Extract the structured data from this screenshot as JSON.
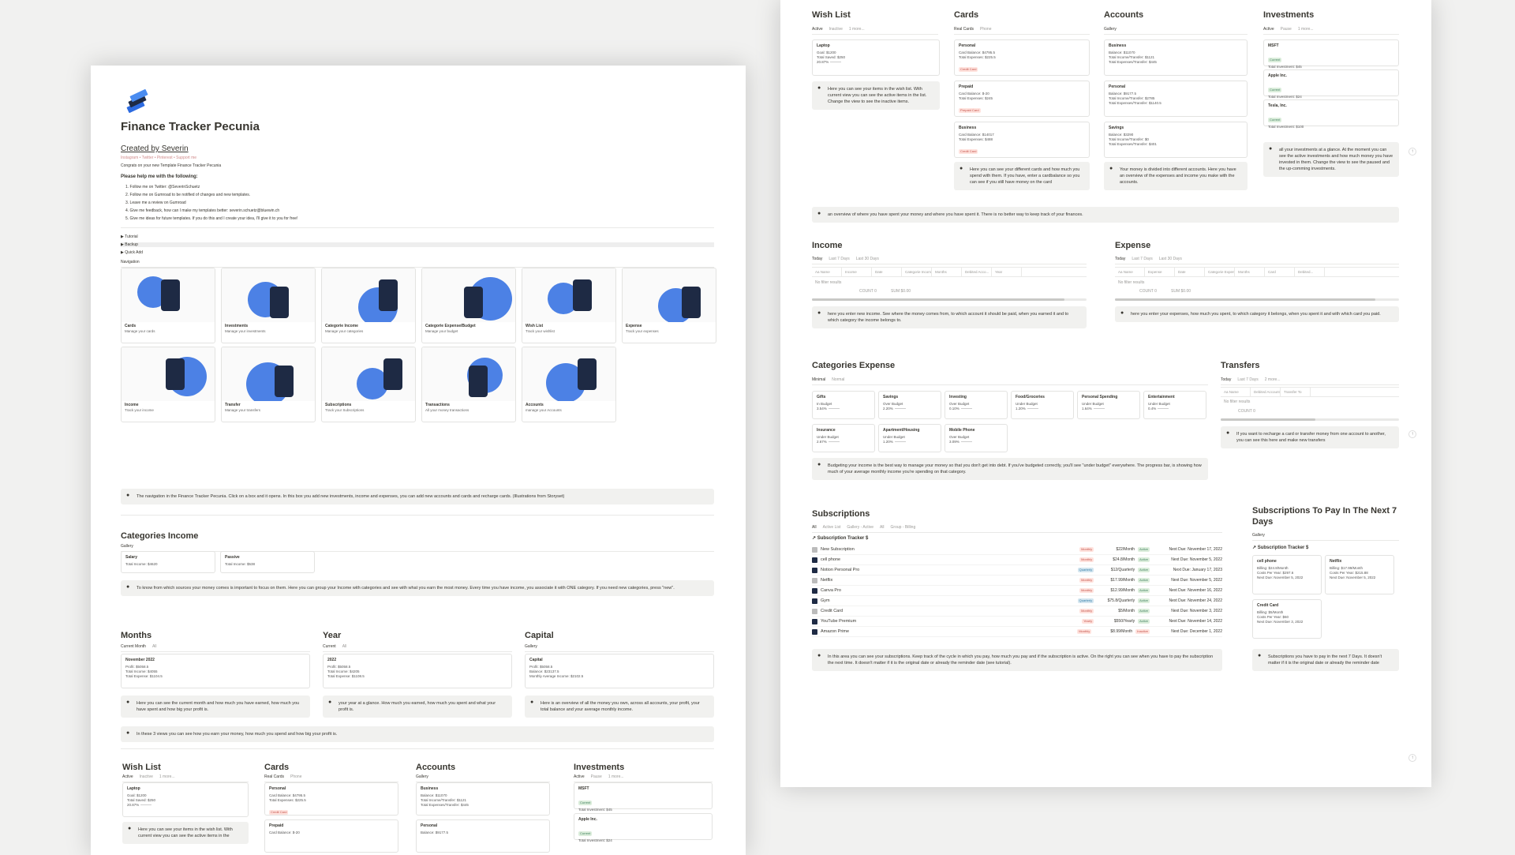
{
  "p1": {
    "title": "Finance Tracker Pecunia",
    "created_by": "Created by Severin",
    "links": "Instagram • Twitter • Pinterest • Support me",
    "congrats": "Congrats on your new Template Finance Tracker Pecunia",
    "help_heading": "Please help me with the following:",
    "help_items": [
      "1. Follow me on Twitter: @SeverinSchuetz",
      "2. Follow me on Gumroad to be notified of changes and new templates.",
      "3. Leave me a review on Gumroad",
      "4. Give me feedback, how can I make my templates better: severin.schuetz@bluewin.ch",
      "5. Give me ideas for future templates. If you do this and I create your idea, I'll give it to you for free!"
    ],
    "toggles": [
      "Tutorial",
      "Backup",
      "Quick Add"
    ],
    "nav_view": "Navigation",
    "nav_tiles": [
      {
        "label": "Cards",
        "sub": "Manage your cards"
      },
      {
        "label": "Investments",
        "sub": "Manage your investments"
      },
      {
        "label": "Categorie Income",
        "sub": "Manage your categories"
      },
      {
        "label": "Categorie Expense/Budget",
        "sub": "Manage your budget"
      },
      {
        "label": "Wish List",
        "sub": "Track your wishlist"
      },
      {
        "label": "Expense",
        "sub": "Track your expenses"
      },
      {
        "label": "Income",
        "sub": "Track your income"
      },
      {
        "label": "Transfer",
        "sub": "Manage your transfers"
      },
      {
        "label": "Subscriptions",
        "sub": "Track your Subscriptions"
      },
      {
        "label": "Transactions",
        "sub": "All your money transactions"
      },
      {
        "label": "Accounts",
        "sub": "manage your Accounts"
      }
    ],
    "nav_callout": "The navigation in the Finance Tracker Pecunia. Click on a box and it opens. In this box you add new investments, income and expenses, you can add new accounts and cards and recharge cards. (Illustrations from Storyset)",
    "cat_income": {
      "title": "Categories Income",
      "view": "Gallery",
      "cards": [
        {
          "t": "Salary",
          "l": "Total Income: $4620"
        },
        {
          "t": "Passive",
          "l": "Total Income: $538"
        }
      ],
      "callout": "To know from which sources your money comes is important to focus on them. Here you can group your Income with categories and see with what you earn the most money. Every time you have income, you associate it with ONE category. If you need new categories, press \"new\"."
    },
    "months": {
      "title": "Months",
      "views": [
        "Current Month",
        "All"
      ],
      "card_t": "November 2022",
      "lines": [
        "Profit: $5058.5",
        "Total Income: $4055",
        "Total Expense: $1104.5"
      ],
      "callout": "Here you can see the current month and how much you have earned, how much you have spent and how big your profit is."
    },
    "year": {
      "title": "Year",
      "views": [
        "Current",
        "All"
      ],
      "card_t": "2022",
      "lines": [
        "Profit: $5058.5",
        "Total Income: $4205",
        "Total Expense: $1108.5"
      ],
      "callout": "your year at a glance. How much you earned, how much you spent and what your profit is."
    },
    "capital": {
      "title": "Capital",
      "views": [
        "Gallery"
      ],
      "card_t": "Capital",
      "lines": [
        "Profit: $5058.5",
        "Balance: $23137.5",
        "Monthly Average Income: $2102.5"
      ],
      "callout": "Here is an overview of all the money you own, across all accounts, your profit, your total balance and your average monthly income."
    },
    "three_views_callout": "In these 3 views you can see how you earn your money, how much you spend and how big your profit is.",
    "bottom": {
      "wish": {
        "title": "Wish List",
        "views": [
          "Active",
          "Inactive",
          "1 more..."
        ],
        "card_t": "Laptop",
        "lines": [
          "Goal: $1200",
          "Total Saved: $250",
          "20.87%"
        ],
        "callout": "Here you can see your items in the wish list. With current view you can see the active items in the"
      },
      "cards": {
        "title": "Cards",
        "views": [
          "Real Cards",
          "Phone"
        ],
        "c1": "Personal",
        "c1l": [
          "Card Balance: $4795.5",
          "Total Expenses: $225.5"
        ],
        "c1tag": "Credit Card",
        "c2": "Prepaid",
        "c2l": [
          "Card Balance: $-20"
        ]
      },
      "accounts": {
        "title": "Accounts",
        "views": [
          "Gallery"
        ],
        "c1": "Business",
        "c1l": [
          "Balance: $11070",
          "Total Income/Transfer: $1121",
          "Total Expenses/Transfer: $445"
        ],
        "c2": "Personal",
        "c2l": [
          "Balance: $9177.5"
        ]
      },
      "invest": {
        "title": "Investments",
        "views": [
          "Active",
          "Pause",
          "1 more..."
        ],
        "c1": "MSFT",
        "c1tag": "Current",
        "c1l": [
          "Total Investment: $45"
        ],
        "c2": "Apple Inc.",
        "c2tag": "Current",
        "c2l": [
          "Total Investment: $24"
        ]
      }
    }
  },
  "p2": {
    "wish": {
      "title": "Wish List",
      "views": [
        "Active",
        "Inactive",
        "1 more..."
      ],
      "card_t": "Laptop",
      "lines": [
        "Goal: $1200",
        "Total Saved: $250",
        "20.87%"
      ],
      "callout": "Here you can see your items in the wish list. With current view you can see the active items in the list. Change the view to see the inactive items."
    },
    "cards": {
      "title": "Cards",
      "views": [
        "Real Cards",
        "Phone"
      ],
      "items": [
        {
          "t": "Personal",
          "l": [
            "Card Balance: $4795.5",
            "Total Expenses: $225.5"
          ],
          "tag": "Credit Card"
        },
        {
          "t": "Prepaid",
          "l": [
            "Card Balance: $-20",
            "Total Expenses: $245"
          ],
          "tag": "Prepaid Card"
        },
        {
          "t": "Business",
          "l": [
            "Card Balance: $14017",
            "Total Expenses: $488"
          ],
          "tag": "Credit Card"
        }
      ],
      "callout": "Here you can see your different cards and how much you spend with them. If you have, enter a cardbalance so you can see if you still have money on the card"
    },
    "accounts": {
      "title": "Accounts",
      "views": [
        "Gallery"
      ],
      "items": [
        {
          "t": "Business",
          "l": [
            "Balance: $11070",
            "Total Income/Transfer: $1121",
            "Total Expenses/Transfer: $445"
          ]
        },
        {
          "t": "Personal",
          "l": [
            "Balance: $9177.5",
            "Total Income/Transfer: $2785",
            "Total Expenses/Transfer: $1140.5"
          ]
        },
        {
          "t": "Savings",
          "l": [
            "Balance: $3290",
            "Total Income/Transfer: $0",
            "Total Expenses/Transfer: $401"
          ]
        }
      ],
      "callout": "Your money is divided into different accounts. Here you have an overview of the expenses and income you make with the accounts."
    },
    "invest": {
      "title": "Investments",
      "views": [
        "Active",
        "Pause",
        "1 more..."
      ],
      "items": [
        {
          "t": "MSFT",
          "tag": "Current",
          "l": "Total Investment: $45"
        },
        {
          "t": "Apple Inc.",
          "tag": "Current",
          "l": "Total Investment: $24"
        },
        {
          "t": "Tesla, Inc.",
          "tag": "Current",
          "l": "Total Investment: $100"
        }
      ],
      "callout": "all your investments at a glance. At the moment you can see the active investments and how much money you have invested in them. Change the view to see the paused and the up-comming investments."
    },
    "overview_callout": "an overview of where you have spent your money and where you have spent it. There is no better way to keep track of your finances.",
    "income": {
      "title": "Income",
      "views": [
        "Today",
        "Last 7 Days",
        "Last 30 Days"
      ],
      "cols": [
        "Aa Name",
        "Income",
        "Date",
        "Categorie Income",
        "Months",
        "Debited Acco...",
        "Year"
      ],
      "empty": "No filter results",
      "sum": "COUNT 0",
      "sum2": "SUM $0.00",
      "callout": "here you enter new income. See where the money comes from, to which account it should be paid, when you earned it and to which category the income belongs to."
    },
    "expense": {
      "title": "Expense",
      "views": [
        "Today",
        "Last 7 Days",
        "Last 30 Days"
      ],
      "cols": [
        "Aa Name",
        "Expense",
        "Date",
        "Categorie Expense",
        "Months",
        "Card",
        "Debited..."
      ],
      "empty": "No filter results",
      "sum": "COUNT 0",
      "sum2": "SUM $0.00",
      "callout": "here you enter your expenses, how much you spent, to which category it belongs, when you spent it and with which card you paid."
    },
    "cat_exp": {
      "title": "Categories Expense",
      "views": [
        "Minimal",
        "Normal"
      ],
      "items": [
        {
          "t": "Gifts",
          "s": "In Budget",
          "p": "3.54%"
        },
        {
          "t": "Savings",
          "s": "Over Budget",
          "p": "2.20%"
        },
        {
          "t": "Investing",
          "s": "Over Budget",
          "p": "0.10%"
        },
        {
          "t": "Food/Groceries",
          "s": "Under Budget",
          "p": "1.20%"
        },
        {
          "t": "Personal Spending",
          "s": "Under Budget",
          "p": "1.64%"
        },
        {
          "t": "Entertainment",
          "s": "Under Budget",
          "p": "0.4%"
        },
        {
          "t": "Insurance",
          "s": "Under Budget",
          "p": "2.67%"
        },
        {
          "t": "Apartment/Housing",
          "s": "Under Budget",
          "p": "1.20%"
        },
        {
          "t": "Mobile Phone",
          "s": "Over Budget",
          "p": "3.09%"
        }
      ],
      "callout": "Budgeting your income is the best way to manage your money so that you don't get into debt. If you've budgeted correctly, you'll see \"under budget\" everywhere. The progress bar, is showing how much of your average monthly income you're spending on that category."
    },
    "transfers": {
      "title": "Transfers",
      "views": [
        "Today",
        "Last 7 Days",
        "2 more..."
      ],
      "cols": [
        "Aa Name",
        "Debited Account",
        "Transfer To"
      ],
      "empty": "No filter results",
      "sum": "COUNT 0",
      "callout": "If you want to recharge a card or transfer money from one account to another, you can see this here and make new transfers"
    },
    "subs": {
      "title": "Subscriptions",
      "views": [
        "All",
        "Active List",
        "Gallery - Active",
        "All",
        "Group - Billing"
      ],
      "db_title": "Subscription Tracker $",
      "rows": [
        {
          "n": "New Subscription",
          "b": "Monthly",
          "bc": "red",
          "p": "$22/Month",
          "s": "Active",
          "d": "Next Due: November 17, 2022"
        },
        {
          "n": "cell phone",
          "b": "Monthly",
          "bc": "red",
          "p": "$24.8/Month",
          "s": "Active",
          "d": "Next Due: November 5, 2022"
        },
        {
          "n": "Notion Personal Pro",
          "b": "Quarterly",
          "bc": "blue",
          "p": "$12/Quarterly",
          "s": "Active",
          "d": "Next Due: January 17, 2023"
        },
        {
          "n": "Netflix",
          "b": "Monthly",
          "bc": "red",
          "p": "$17.99/Month",
          "s": "Active",
          "d": "Next Due: November 5, 2022"
        },
        {
          "n": "Canva Pro",
          "b": "Monthly",
          "bc": "red",
          "p": "$12.99/Month",
          "s": "Active",
          "d": "Next Due: November 16, 2022"
        },
        {
          "n": "Gym",
          "b": "Quarterly",
          "bc": "blue",
          "p": "$75.8/Quarterly",
          "s": "Active",
          "d": "Next Due: November 24, 2022"
        },
        {
          "n": "Credit Card",
          "b": "Monthly",
          "bc": "red",
          "p": "$5/Month",
          "s": "Active",
          "d": "Next Due: November 3, 2022"
        },
        {
          "n": "YouTube Premium",
          "b": "Yearly",
          "bc": "red",
          "p": "$550/Yearly",
          "s": "Active",
          "d": "Next Due: November 14, 2022"
        },
        {
          "n": "Amazon Prime",
          "b": "Monthly",
          "bc": "red",
          "p": "$8.99/Month",
          "s": "Inactive",
          "d": "Next Due: December 1, 2022"
        }
      ],
      "callout": "In this area you can see your subscriptions. Keep track of the cycle in which you pay, how much you pay and if the subscription is active. On the right you can see when you have to pay the subscription the next time. It doesn't matter if it is the original date or already the reminder date (see tutorial)."
    },
    "next7": {
      "title": "Subscriptions To Pay In The Next 7 Days",
      "view": "Gallery",
      "db_title": "Subscription Tracker $",
      "items": [
        {
          "t": "cell phone",
          "l": [
            "Billing: $24.8/Month",
            "Costs Per Year: $297.6",
            "Next Due: November 5, 2022"
          ]
        },
        {
          "t": "Netflix",
          "l": [
            "Billing: $17.99/Month",
            "Costs Per Year: $215.88",
            "Next Due: November 5, 2022"
          ]
        },
        {
          "t": "Credit Card",
          "l": [
            "Billing: $5/Month",
            "Costs Per Year: $60",
            "Next Due: November 3, 2022"
          ]
        }
      ],
      "callout": "Subscriptions you have to pay in the next 7 Days. It doesn't matter if it is the original date or already the reminder date"
    }
  }
}
